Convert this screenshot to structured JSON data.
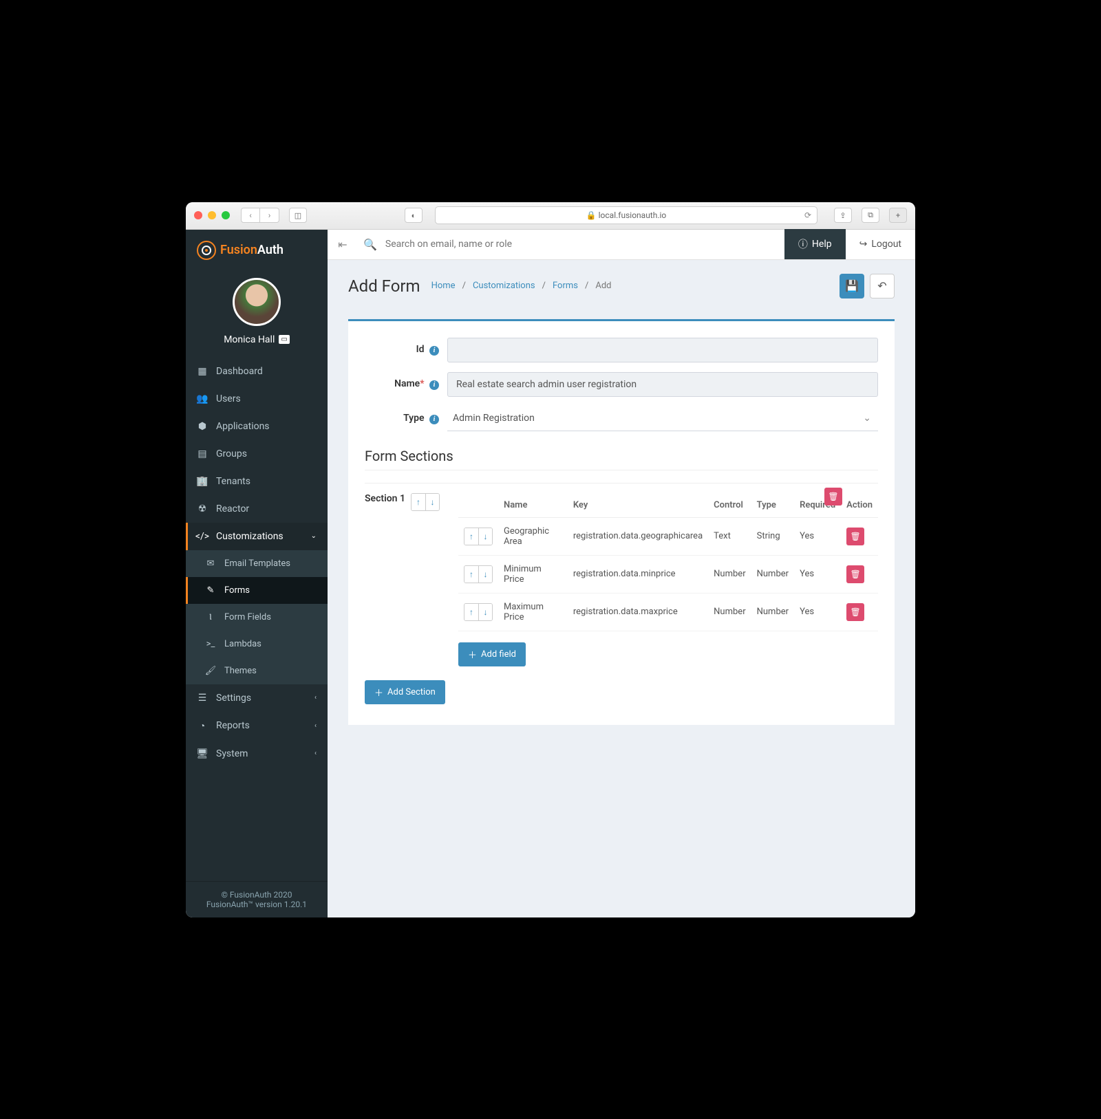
{
  "browser": {
    "url": "local.fusionauth.io"
  },
  "brand": {
    "name_a": "Fusion",
    "name_b": "Auth"
  },
  "user": {
    "name": "Monica Hall"
  },
  "sidebar": {
    "items": [
      {
        "label": "Dashboard"
      },
      {
        "label": "Users"
      },
      {
        "label": "Applications"
      },
      {
        "label": "Groups"
      },
      {
        "label": "Tenants"
      },
      {
        "label": "Reactor"
      },
      {
        "label": "Customizations"
      },
      {
        "label": "Email Templates"
      },
      {
        "label": "Forms"
      },
      {
        "label": "Form Fields"
      },
      {
        "label": "Lambdas"
      },
      {
        "label": "Themes"
      },
      {
        "label": "Settings"
      },
      {
        "label": "Reports"
      },
      {
        "label": "System"
      }
    ]
  },
  "topbar": {
    "search_placeholder": "Search on email, name or role",
    "help": "Help",
    "logout": "Logout"
  },
  "page": {
    "title": "Add Form",
    "crumbs": [
      "Home",
      "Customizations",
      "Forms",
      "Add"
    ]
  },
  "form": {
    "labels": {
      "id": "Id",
      "name": "Name",
      "type": "Type"
    },
    "id": "",
    "name": "Real estate search admin user registration",
    "type": "Admin Registration"
  },
  "sections_heading": "Form Sections",
  "section": {
    "label": "Section 1",
    "columns": {
      "name": "Name",
      "key": "Key",
      "control": "Control",
      "type": "Type",
      "required": "Required",
      "action": "Action"
    },
    "rows": [
      {
        "name": "Geographic Area",
        "key": "registration.data.geographicarea",
        "control": "Text",
        "type": "String",
        "required": "Yes"
      },
      {
        "name": "Minimum Price",
        "key": "registration.data.minprice",
        "control": "Number",
        "type": "Number",
        "required": "Yes"
      },
      {
        "name": "Maximum Price",
        "key": "registration.data.maxprice",
        "control": "Number",
        "type": "Number",
        "required": "Yes"
      }
    ]
  },
  "buttons": {
    "add_field": "Add field",
    "add_section": "Add Section"
  },
  "footer": {
    "copyright": "© FusionAuth 2020",
    "version": "FusionAuth™ version 1.20.1"
  }
}
